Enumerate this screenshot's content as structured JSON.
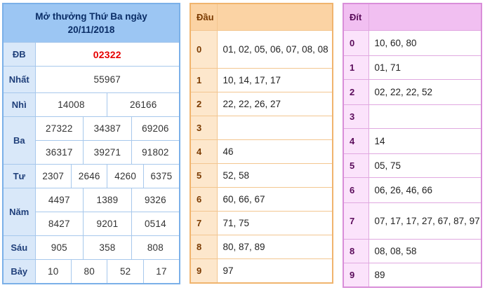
{
  "results": {
    "title_line1": "Mở thưởng Thứ Ba ngày",
    "title_line2": "20/11/2018",
    "prizes": {
      "db": {
        "label": "ĐB",
        "values": [
          "02322"
        ]
      },
      "nhat": {
        "label": "Nhất",
        "values": [
          "55967"
        ]
      },
      "nhi": {
        "label": "Nhì",
        "values": [
          "14008",
          "26166"
        ]
      },
      "ba": {
        "label": "Ba",
        "values": [
          "27322",
          "34387",
          "69206",
          "36317",
          "39271",
          "91802"
        ]
      },
      "tu": {
        "label": "Tư",
        "values": [
          "2307",
          "2646",
          "4260",
          "6375"
        ]
      },
      "nam": {
        "label": "Năm",
        "values": [
          "4497",
          "1389",
          "9326",
          "8427",
          "9201",
          "0514"
        ]
      },
      "sau": {
        "label": "Sáu",
        "values": [
          "905",
          "358",
          "808"
        ]
      },
      "bay": {
        "label": "Bảy",
        "values": [
          "10",
          "80",
          "52",
          "17"
        ]
      }
    }
  },
  "dau": {
    "header": "Đầu",
    "rows": [
      {
        "k": "0",
        "v": "01, 02, 05, 06, 07, 08, 08"
      },
      {
        "k": "1",
        "v": "10, 14, 17, 17"
      },
      {
        "k": "2",
        "v": "22, 22, 26, 27"
      },
      {
        "k": "3",
        "v": ""
      },
      {
        "k": "4",
        "v": "46"
      },
      {
        "k": "5",
        "v": "52, 58"
      },
      {
        "k": "6",
        "v": "60, 66, 67"
      },
      {
        "k": "7",
        "v": "71, 75"
      },
      {
        "k": "8",
        "v": "80, 87, 89"
      },
      {
        "k": "9",
        "v": "97"
      }
    ]
  },
  "dit": {
    "header": "Đít",
    "rows": [
      {
        "k": "0",
        "v": "10, 60, 80"
      },
      {
        "k": "1",
        "v": "01, 71"
      },
      {
        "k": "2",
        "v": "02, 22, 22, 52"
      },
      {
        "k": "3",
        "v": ""
      },
      {
        "k": "4",
        "v": "14"
      },
      {
        "k": "5",
        "v": "05, 75"
      },
      {
        "k": "6",
        "v": "06, 26, 46, 66"
      },
      {
        "k": "7",
        "v": "07, 17, 17, 27, 67, 87, 97"
      },
      {
        "k": "8",
        "v": "08, 08, 58"
      },
      {
        "k": "9",
        "v": "89"
      }
    ]
  }
}
